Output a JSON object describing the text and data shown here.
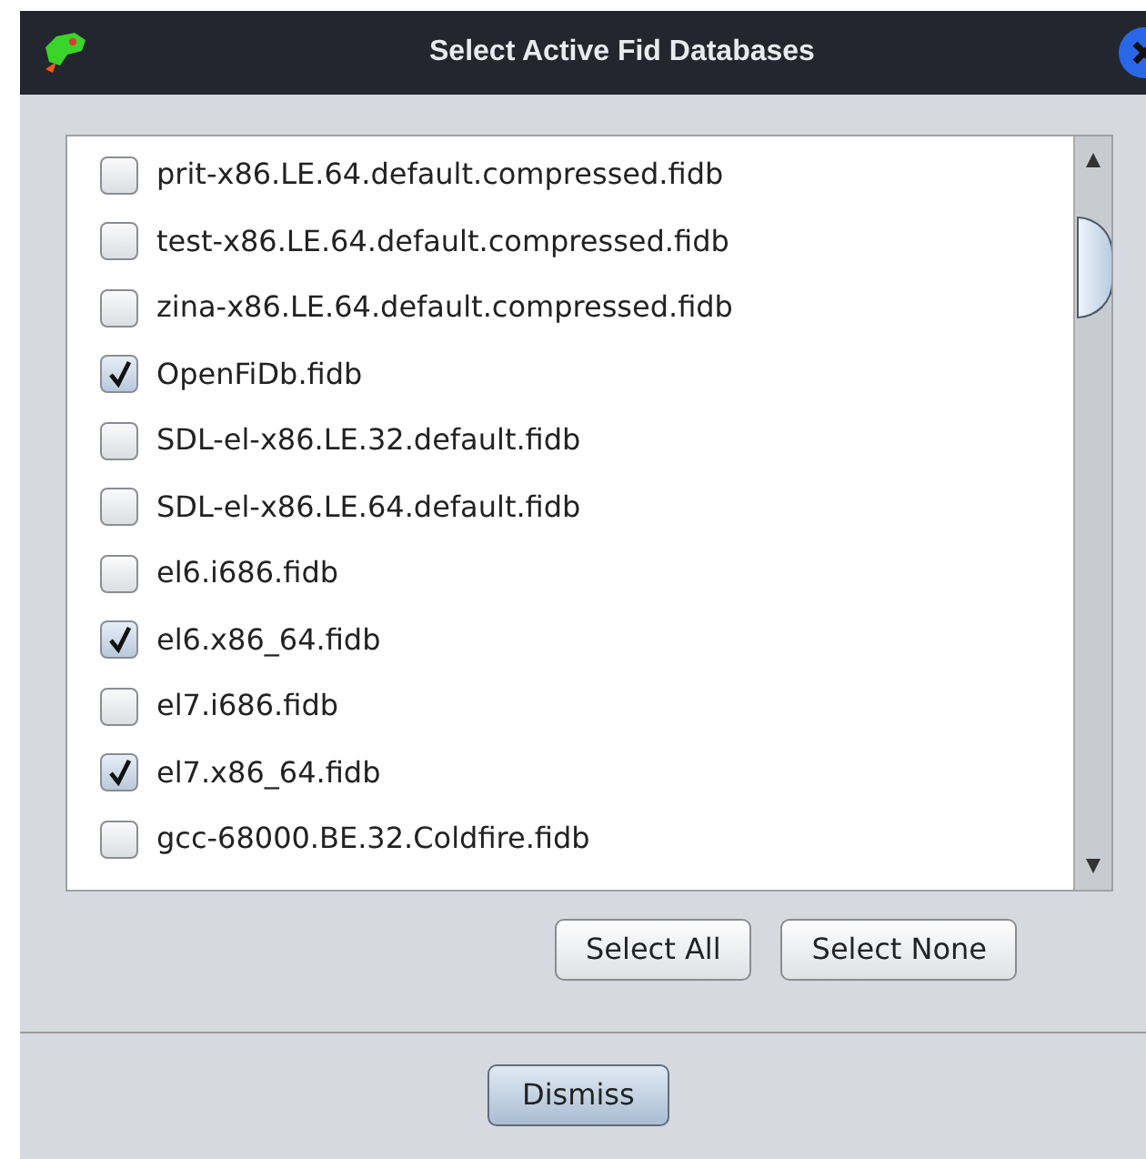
{
  "window": {
    "title": "Select Active Fid Databases"
  },
  "databases": [
    {
      "label": "prit-x86.LE.64.default.compressed.fidb",
      "checked": false
    },
    {
      "label": "test-x86.LE.64.default.compressed.fidb",
      "checked": false
    },
    {
      "label": "zina-x86.LE.64.default.compressed.fidb",
      "checked": false
    },
    {
      "label": "OpenFiDb.fidb",
      "checked": true
    },
    {
      "label": "SDL-el-x86.LE.32.default.fidb",
      "checked": false
    },
    {
      "label": "SDL-el-x86.LE.64.default.fidb",
      "checked": false
    },
    {
      "label": "el6.i686.fidb",
      "checked": false
    },
    {
      "label": "el6.x86_64.fidb",
      "checked": true
    },
    {
      "label": "el7.i686.fidb",
      "checked": false
    },
    {
      "label": "el7.x86_64.fidb",
      "checked": true
    },
    {
      "label": "gcc-68000.BE.32.Coldfire.fidb",
      "checked": false
    }
  ],
  "buttons": [
    "Select All",
    "Select None"
  ],
  "footer_button": "Dismiss"
}
